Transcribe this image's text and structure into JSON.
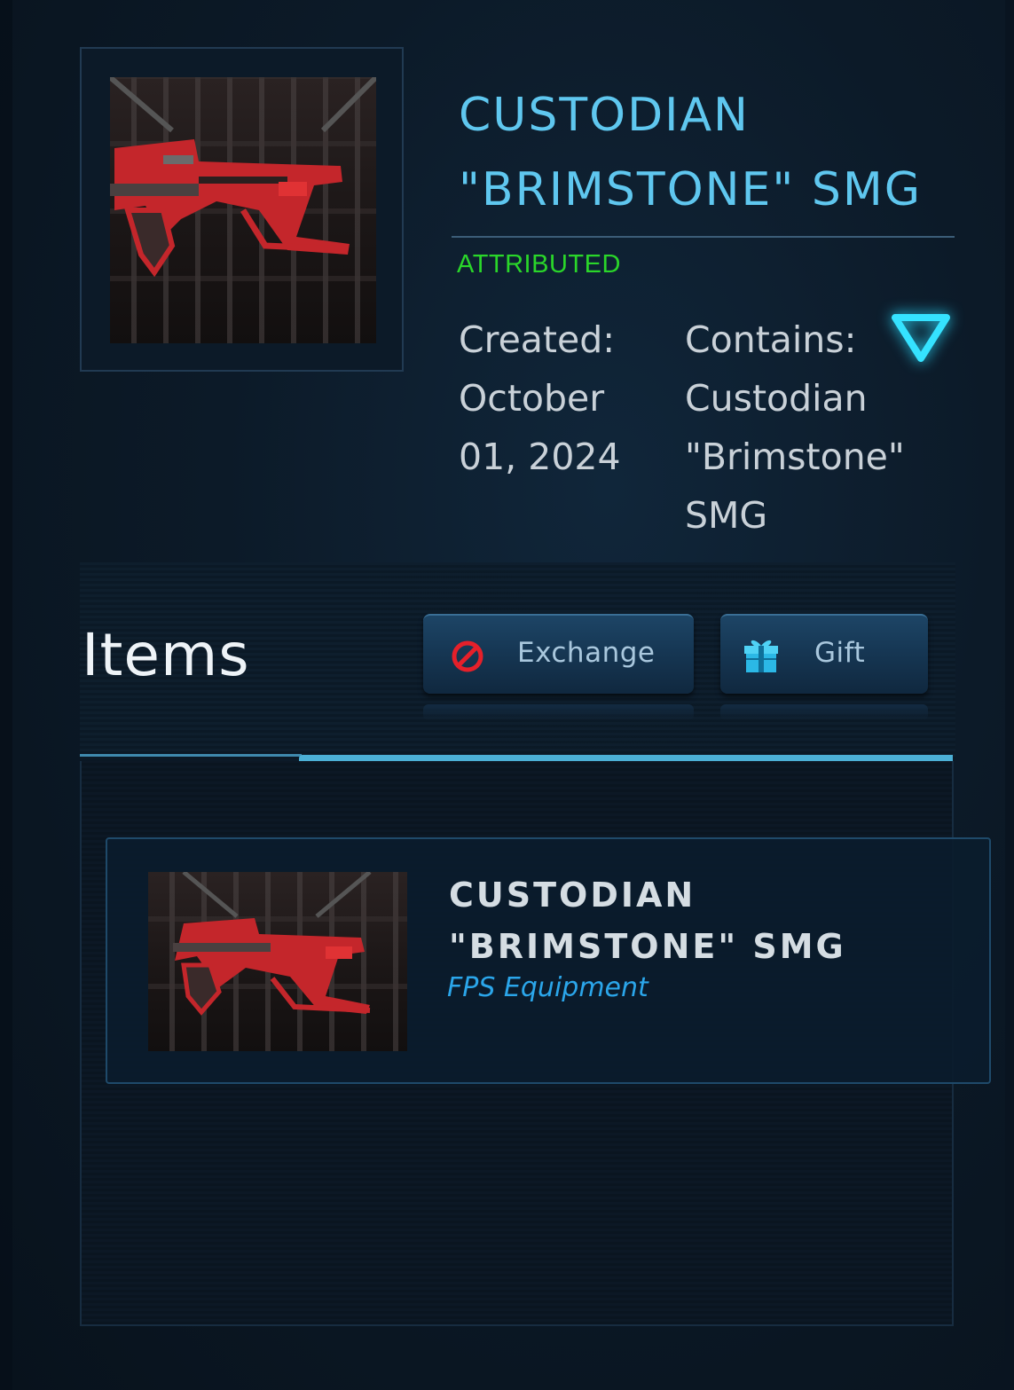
{
  "header": {
    "title": "CUSTODIAN \"BRIMSTONE\" SMG",
    "status": "ATTRIBUTED",
    "created_label": "Created:",
    "created_value": "October 01, 2024",
    "contains_label": "Contains:",
    "contains_value": "Custodian \"Brimstone\" SMG",
    "expand_icon": "triangle-down-icon"
  },
  "items_section": {
    "heading": "Items",
    "buttons": [
      {
        "label": "Exchange",
        "icon": "no-entry-icon"
      },
      {
        "label": "Gift",
        "icon": "gift-icon"
      }
    ]
  },
  "items": [
    {
      "title": "CUSTODIAN \"BRIMSTONE\" SMG",
      "category": "FPS Equipment"
    }
  ],
  "colors": {
    "title": "#5fc7ef",
    "status": "#2ad62a",
    "category": "#2ba6ea",
    "accent_rule": "#4cb0d6",
    "background": "#0b1724"
  }
}
